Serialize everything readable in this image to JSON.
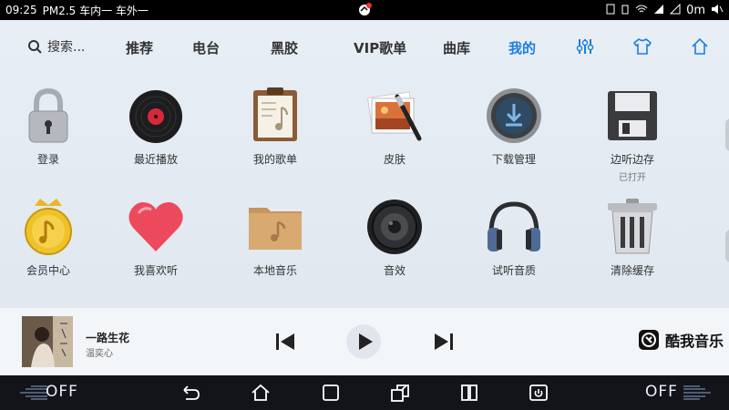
{
  "status_bar": {
    "time": "09:25",
    "air": "PM2.5 车内一 车外一",
    "right_text": "0m"
  },
  "nav": {
    "search_label": "搜索...",
    "tabs": [
      "推荐",
      "电台",
      "黑胶",
      "VIP歌单",
      "曲库",
      "我的"
    ],
    "active_tab": "我的",
    "accent_color": "#1a7fe0",
    "icons": [
      "equalizer-icon",
      "shirt-icon",
      "home-icon"
    ]
  },
  "grid": {
    "row1": [
      {
        "label": "登录",
        "icon": "padlock-icon"
      },
      {
        "label": "最近播放",
        "icon": "vinyl-record-icon"
      },
      {
        "label": "我的歌单",
        "icon": "clipboard-music-icon"
      },
      {
        "label": "皮肤",
        "icon": "photo-brush-icon"
      },
      {
        "label": "下载管理",
        "icon": "download-icon"
      },
      {
        "label": "边听边存",
        "sub": "已打开",
        "icon": "floppy-disk-icon"
      }
    ],
    "row2": [
      {
        "label": "会员中心",
        "icon": "crown-coin-icon"
      },
      {
        "label": "我喜欢听",
        "icon": "heart-icon"
      },
      {
        "label": "本地音乐",
        "icon": "folder-music-icon"
      },
      {
        "label": "音效",
        "icon": "speaker-icon"
      },
      {
        "label": "试听音质",
        "icon": "headphones-icon"
      },
      {
        "label": "清除缓存",
        "icon": "trash-can-icon"
      }
    ]
  },
  "player": {
    "title": "一路生花",
    "artist": "温奕心",
    "brand": "酷我音乐"
  },
  "system_bar": {
    "left_label": "OFF",
    "right_label": "OFF"
  }
}
